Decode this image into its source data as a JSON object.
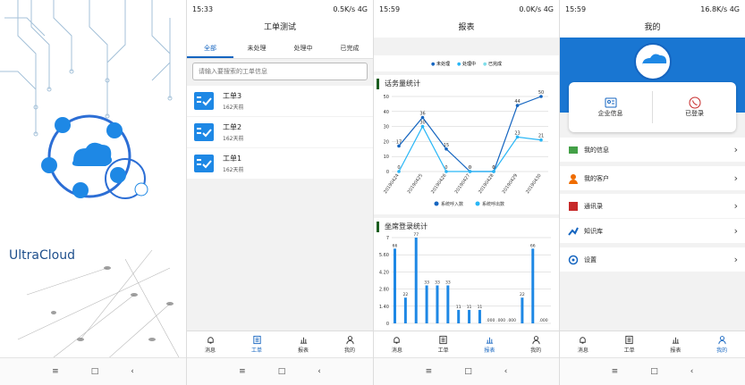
{
  "splash": {
    "brand": "UltraCloud"
  },
  "p2": {
    "status": {
      "time": "15:33",
      "net": "0.5K/s",
      "sig": "4G"
    },
    "title": "工单测试",
    "filters": [
      "全部",
      "未处理",
      "处理中",
      "已完成"
    ],
    "search_placeholder": "请输入要搜索的工单信息",
    "tickets": [
      {
        "name": "工单3",
        "time": "162天前"
      },
      {
        "name": "工单2",
        "time": "162天前"
      },
      {
        "name": "工单1",
        "time": "162天前"
      }
    ]
  },
  "p3": {
    "status": {
      "time": "15:59",
      "net": "0.0K/s",
      "sig": "4G"
    },
    "title": "报表",
    "legend": [
      "未处理",
      "处理中",
      "已完成"
    ],
    "sec1": "话务量统计",
    "sec2": "坐席登录统计",
    "line_legend": [
      "系统呼入数",
      "系统呼出数"
    ],
    "bar_yticks": [
      "0",
      "1.40",
      "2.80",
      "4.20",
      "5.60",
      "7"
    ],
    "bar_labels": [
      "66",
      "22",
      "77",
      "33",
      "33",
      "33",
      "11",
      "11",
      "11",
      ".000",
      ".000",
      ".000",
      "22",
      "66",
      ".000"
    ]
  },
  "p4": {
    "status": {
      "time": "15:59",
      "net": "16.8K/s",
      "sig": "4G"
    },
    "title": "我的",
    "card": [
      "企业信息",
      "已登录"
    ],
    "menu": [
      "我的信息",
      "我的客户",
      "通讯录",
      "知识库",
      "设置"
    ]
  },
  "tabs": [
    "消息",
    "工单",
    "报表",
    "我的"
  ],
  "chart_data": [
    {
      "type": "line",
      "title": "话务量统计",
      "x": [
        "20190424",
        "20190425",
        "20190426",
        "20190427",
        "20190428",
        "20190429",
        "20190430"
      ],
      "ylim": [
        0,
        50
      ],
      "yticks": [
        "0",
        "10",
        "20",
        "30",
        "40",
        "50"
      ],
      "series": [
        {
          "name": "系统呼入数",
          "values": [
            17,
            36,
            15,
            0,
            0,
            44,
            50
          ]
        },
        {
          "name": "系统呼出数",
          "values": [
            0,
            30,
            0,
            0,
            0,
            23,
            21
          ]
        }
      ]
    },
    {
      "type": "bar",
      "title": "坐席登录统计",
      "ylim": [
        0,
        7
      ],
      "yticks": [
        "0",
        "1.40",
        "2.80",
        "4.20",
        "5.60",
        "7"
      ],
      "values": [
        6.1,
        2.1,
        7,
        3.1,
        3.1,
        3.1,
        1.1,
        1.1,
        1.1,
        0,
        0,
        0,
        2.1,
        6.1,
        0
      ]
    }
  ]
}
